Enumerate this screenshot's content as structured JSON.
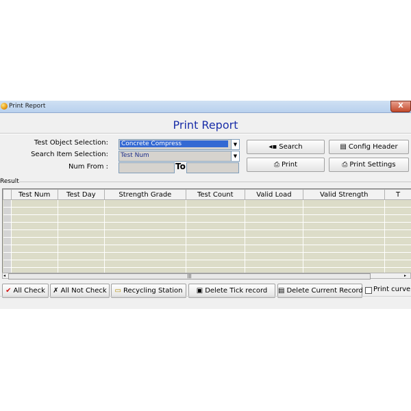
{
  "window": {
    "title": "Print Report",
    "close_glyph": "X"
  },
  "header": {
    "title": "Print Report"
  },
  "form": {
    "test_object_label": "Test Object Selection:",
    "test_object_value": "Concrete Compress",
    "search_item_label": "Search Item Selection:",
    "search_item_value": "Test Num",
    "num_from_label": "Num From :",
    "to_label": "To"
  },
  "buttons": {
    "search": "Search",
    "config_header": "Config Header",
    "print": "Print",
    "print_settings": "Print Settings"
  },
  "result": {
    "label": "Result",
    "columns": [
      "Test Num",
      "Test Day",
      "Strength Grade",
      "Test Count",
      "Valid Load",
      "Valid Strength",
      "T"
    ],
    "rows": []
  },
  "bottom_bar": {
    "all_check": "All Check",
    "all_not_check": "All Not Check",
    "recycling_station": "Recycling Station",
    "delete_tick_record": "Delete Tick record",
    "delete_current_record": "Delete Current Record",
    "print_curve": "Print curve",
    "print_curve_checked": false
  },
  "colors": {
    "title_blue": "#1a2ea8",
    "selection": "#3469d3",
    "grid_bg": "#dcdcc8"
  }
}
